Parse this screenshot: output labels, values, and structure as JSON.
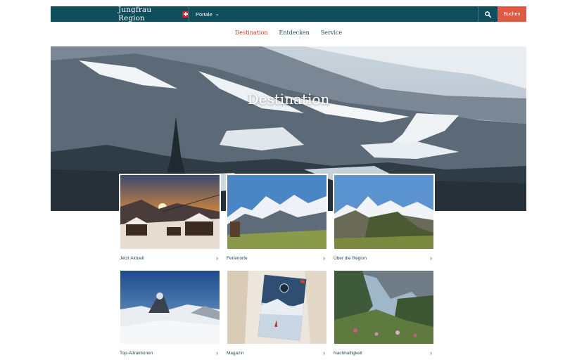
{
  "header": {
    "brand": "Jungfrau Region",
    "portale_label": "Portale",
    "book_label": "Buchen"
  },
  "nav": {
    "tabs": [
      {
        "label": "Destination",
        "active": true
      },
      {
        "label": "Entdecken",
        "active": false
      },
      {
        "label": "Service",
        "active": false
      }
    ]
  },
  "hero": {
    "title": "Destination"
  },
  "tiles": [
    {
      "label": "Jetzt Aktuell"
    },
    {
      "label": "Ferienorte"
    },
    {
      "label": "Über die Region"
    },
    {
      "label": "Top-Attraktionen"
    },
    {
      "label": "Magazin"
    },
    {
      "label": "Nachhaltigkeit"
    }
  ],
  "colors": {
    "header_bg": "#0f4f5d",
    "book_button": "#e05a43",
    "active_tab": "#c5392a",
    "link_text": "#1d4c5a"
  },
  "icons": {
    "brand_mark": "swiss-cross-icon",
    "search": "search-icon",
    "portale": "chevron-down-icon",
    "tile_link": "chevron-right-icon"
  }
}
